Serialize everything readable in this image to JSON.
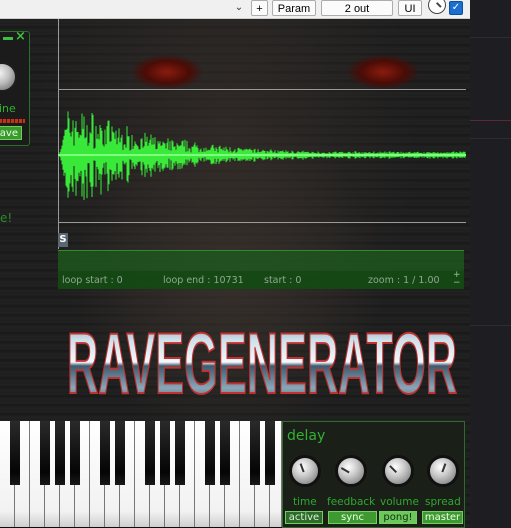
{
  "toolbar": {
    "dropdown_icon": "chevron-down-icon",
    "plus_label": "+",
    "param_label": "Param",
    "output_label": "2 out",
    "ui_label": "UI",
    "checkbox_mark": "✓"
  },
  "left_panel": {
    "close_label": "×",
    "label_fragment": "ine",
    "button_fragment": "ave",
    "partial_text": "e!"
  },
  "waveform": {
    "marker_label": "S",
    "color": "#3cff3c"
  },
  "loop": {
    "loop_start": "loop start : 0",
    "loop_end": "loop end : 10731",
    "start": "start : 0",
    "zoom": "zoom : 1 / 1.00",
    "zoom_plus": "+",
    "zoom_minus": "−"
  },
  "logo": {
    "text": "RAVEGENERATOR"
  },
  "delay": {
    "title": "delay",
    "knobs": [
      {
        "label": "time"
      },
      {
        "label": "feedback"
      },
      {
        "label": "volume"
      },
      {
        "label": "spread"
      }
    ],
    "buttons": {
      "active": "active",
      "sync": "sync",
      "pong": "pong!",
      "master": "master"
    }
  },
  "colors": {
    "accent_green": "#34b034",
    "host_accent": "#c2404a"
  }
}
